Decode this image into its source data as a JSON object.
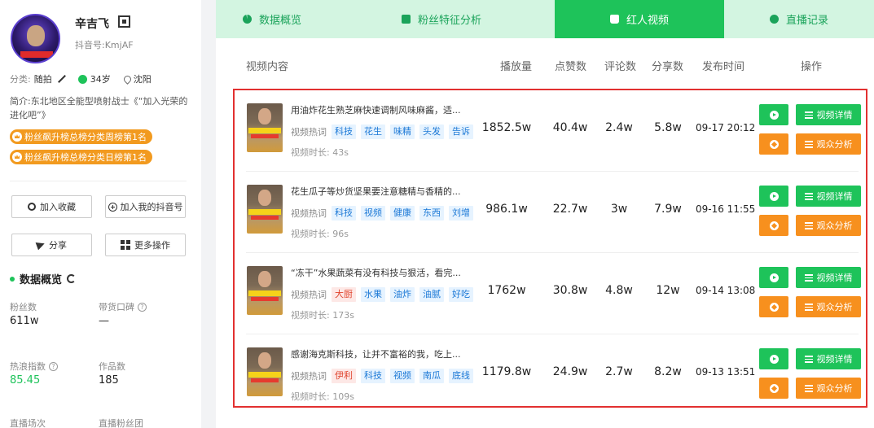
{
  "profile": {
    "name": "辛吉飞",
    "douyin_id": "抖音号:KmjAF",
    "category_label": "分类:",
    "category_value": "随拍",
    "age": "34岁",
    "location": "沈阳",
    "intro": "简介:东北地区全能型喷射战士《“加入光荣的进化吧”》",
    "badges": [
      "粉丝飙升榜总榜分类周榜第1名",
      "粉丝飙升榜总榜分类日榜第1名"
    ],
    "buttons": {
      "collect": "加入收藏",
      "add_mine": "加入我的抖音号",
      "share": "分享",
      "more": "更多操作"
    }
  },
  "overview": {
    "title": "数据概览",
    "stats": [
      {
        "label": "粉丝数",
        "value": "611w"
      },
      {
        "label": "带货口碑",
        "value": "—"
      },
      {
        "label": "热浪指数",
        "value": "85.45"
      },
      {
        "label": "作品数",
        "value": "185"
      },
      {
        "label": "直播场次",
        "value": ""
      },
      {
        "label": "直播粉丝团",
        "value": ""
      }
    ]
  },
  "tabs": [
    "数据概览",
    "粉丝特征分析",
    "红人视频",
    "直播记录"
  ],
  "table": {
    "headers": [
      "视频内容",
      "播放量",
      "点赞数",
      "评论数",
      "分享数",
      "发布时间",
      "操作"
    ],
    "hot_label": "视频热词",
    "duration_prefix": "视频时长:",
    "detail_label": "视频详情",
    "audience_label": "观众分析",
    "rows": [
      {
        "title": "用油炸花生熟芝麻快速调制风味麻酱，适...",
        "tags": [
          {
            "t": "科技",
            "c": "blue"
          },
          {
            "t": "花生",
            "c": "blue"
          },
          {
            "t": "味精",
            "c": "blue"
          },
          {
            "t": "头发",
            "c": "blue"
          },
          {
            "t": "告诉",
            "c": "blue"
          }
        ],
        "duration": "43s",
        "plays": "1852.5w",
        "likes": "40.4w",
        "comments": "2.4w",
        "shares": "5.8w",
        "date": "09-17 20:12"
      },
      {
        "title": "花生瓜子等炒货坚果要注意糖精与香精的...",
        "tags": [
          {
            "t": "科技",
            "c": "blue"
          },
          {
            "t": "视频",
            "c": "blue"
          },
          {
            "t": "健康",
            "c": "blue"
          },
          {
            "t": "东西",
            "c": "blue"
          },
          {
            "t": "刘增",
            "c": "blue"
          }
        ],
        "duration": "96s",
        "plays": "986.1w",
        "likes": "22.7w",
        "comments": "3w",
        "shares": "7.9w",
        "date": "09-16 11:55"
      },
      {
        "title": "“冻干”水果蔬菜有没有科技与狠活，看完...",
        "tags": [
          {
            "t": "大厨",
            "c": "red"
          },
          {
            "t": "水果",
            "c": "blue"
          },
          {
            "t": "油炸",
            "c": "blue"
          },
          {
            "t": "油腻",
            "c": "blue"
          },
          {
            "t": "好吃",
            "c": "blue"
          }
        ],
        "duration": "173s",
        "plays": "1762w",
        "likes": "30.8w",
        "comments": "4.8w",
        "shares": "12w",
        "date": "09-14 13:08"
      },
      {
        "title": "感谢海克斯科技，让并不富裕的我，吃上...",
        "tags": [
          {
            "t": "伊利",
            "c": "red"
          },
          {
            "t": "科技",
            "c": "blue"
          },
          {
            "t": "视频",
            "c": "blue"
          },
          {
            "t": "南瓜",
            "c": "blue"
          },
          {
            "t": "底线",
            "c": "blue"
          }
        ],
        "duration": "109s",
        "plays": "1179.8w",
        "likes": "24.9w",
        "comments": "2.7w",
        "shares": "8.2w",
        "date": "09-13 13:51"
      }
    ]
  },
  "colors": {
    "green": "#1ec35a",
    "orange": "#f7901e",
    "badge": "#f29a1f",
    "highlight": "#e23030",
    "tab_bg": "#d3f5e1"
  }
}
